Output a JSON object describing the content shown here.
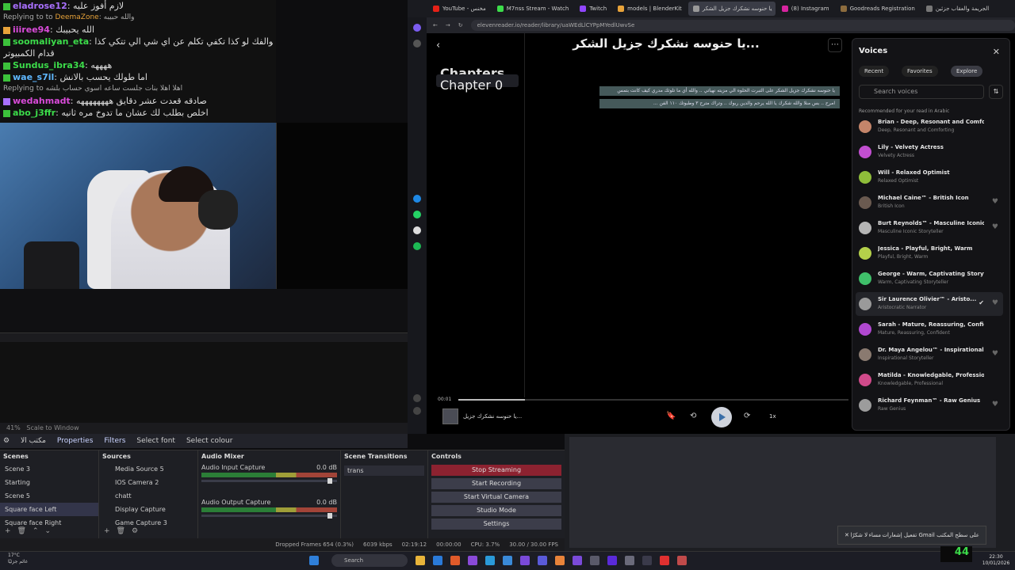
{
  "chat": {
    "lines": [
      {
        "user": "eladrose12",
        "user_color": "#a970ff",
        "text": "لازم أفوز عليه"
      },
      {
        "reply_to": "Replying to",
        "reply_user": "DeemaZone",
        "reply_text": "والله حبيبه"
      },
      {
        "user": "iiiree94",
        "user_color": "#d94bd9",
        "text": "الله يحبيبك"
      },
      {
        "user": "soomaliyan_eta",
        "user_color": "#3cdc4a",
        "text": "يخي سوالفك لو كذا تكفي تكلم عن اي شي الي تتكي كذا"
      },
      {
        "user": "",
        "user_color": "#ffffff",
        "text": "قدام الكمبيوتر"
      },
      {
        "user": "Sundus_ibra34",
        "user_color": "#3cdc4a",
        "text": "ههههه"
      },
      {
        "user": "wae_s7il",
        "user_color": "#5fb8ff",
        "text": "اما طولك يحسب بالانش"
      },
      {
        "reply_to": "Replying to",
        "reply_user": "",
        "reply_text": "اهلا اهلا بنات جلست ساعه اسوي حساب بلشه"
      },
      {
        "user": "wedahmadt",
        "user_color": "#d94bd9",
        "text": "صادقه قعدت عشر دقايق ههههههههه"
      },
      {
        "user": "abo_j3ffr",
        "user_color": "#3cdc4a",
        "text": "اخلص بطلب لك عشان ما تدوخ مره ثانيه"
      }
    ]
  },
  "obs": {
    "zoom": "41%",
    "scale_label": "Scale to Window",
    "toolbar": {
      "source_name": "مكتب الا",
      "properties": "Properties",
      "filters": "Filters",
      "select_font": "Select font",
      "select_colour": "Select colour"
    },
    "scenes": {
      "title": "Scenes",
      "items": [
        "Scene 3",
        "Starting",
        "Scene 5",
        "Square face Left",
        "Square face Right"
      ],
      "selected_index": 3
    },
    "sources": {
      "title": "Sources",
      "items": [
        "Media Source 5",
        "IOS Camera 2",
        "chatt",
        "Display Capture",
        "Game Capture 3"
      ]
    },
    "mixer": {
      "title": "Audio Mixer",
      "channels": [
        {
          "name": "Audio Input Capture",
          "db": "0.0 dB",
          "level": 0.62
        },
        {
          "name": "Audio Output Capture",
          "db": "0.0 dB",
          "level": 0.72
        }
      ]
    },
    "transitions": {
      "title": "Scene Transitions",
      "current": "trans"
    },
    "controls": {
      "title": "Controls",
      "buttons": [
        "Stop Streaming",
        "Start Recording",
        "Start Virtual Camera",
        "Studio Mode",
        "Settings"
      ]
    },
    "status": {
      "dropped": "Dropped Frames 654 (0.3%)",
      "bitrate": "6039 kbps",
      "live_time": "02:19:12",
      "rec_time": "00:00:00",
      "cpu": "CPU: 3.7%",
      "fps": "30.00 / 30.00 FPS"
    }
  },
  "browser": {
    "tabs": [
      {
        "label": "YouTube - مخنس",
        "color": "#e62117",
        "active": false
      },
      {
        "label": "M7nss Stream - Watch",
        "color": "#3cdc4a",
        "active": false
      },
      {
        "label": "Twitch",
        "color": "#9146ff",
        "active": false
      },
      {
        "label": "models | BlenderKit",
        "color": "#e8a33a",
        "active": false
      },
      {
        "label": "يا حنوسه نشكرك جزيل الشكر",
        "color": "#999999",
        "active": true
      },
      {
        "label": "(8) Instagram",
        "color": "#d6249f",
        "active": false
      },
      {
        "label": "Goodreads Registration",
        "color": "#8c6c3e",
        "active": false
      },
      {
        "label": "الجريمة والعقاب جزئين",
        "color": "#777777",
        "active": false
      }
    ],
    "url": "elevenreader.io/reader/library/uaWEdLlCYPpMYedlUwvSe"
  },
  "reader": {
    "title": "يا حنوسه نشكرك جزيل الشكر...",
    "chapters_label": "Chapters",
    "chapter_item": "Chapter 0",
    "highlight_lines": [
      "يا حنوسه نشكرك جزيل الشكر على التبرت الحلوه الي مزيته نهياتي .. والله أي ما تلوثك مدري كيف كانت بتمس",
      "... امرح .. بس منلا والله شكرك يا الله يرحم والدين ربوك .. وتراك مترح ٣ وطبوتك ١١٠ الفن"
    ],
    "player": {
      "time": "00:01",
      "progress": 0.17,
      "now_playing": "يا حنوسه نشكرك جزيل...",
      "speed": "1x"
    }
  },
  "voices": {
    "title": "Voices",
    "tabs": [
      "Recent",
      "Favorites",
      "Explore"
    ],
    "selected_tab": 2,
    "search_placeholder": "Search voices",
    "recommended_label": "Recommended for your read in Arabic",
    "items": [
      {
        "name": "Brian - Deep, Resonant and Comforting",
        "desc": "Deep, Resonant and Comforting",
        "color": "#c4856a",
        "heart": false,
        "selected": false
      },
      {
        "name": "Lily - Velvety Actress",
        "desc": "Velvety Actress",
        "color": "#c24fd0",
        "heart": false,
        "selected": false
      },
      {
        "name": "Will - Relaxed Optimist",
        "desc": "Relaxed Optimist",
        "color": "#8fbd3a",
        "heart": false,
        "selected": false
      },
      {
        "name": "Michael Caine™ - British Icon",
        "desc": "British Icon",
        "color": "#6a5a50",
        "heart": true,
        "selected": false
      },
      {
        "name": "Burt Reynolds™ - Masculine Iconic ...",
        "desc": "Masculine Iconic Storyteller",
        "color": "#b5b5b5",
        "heart": true,
        "selected": false
      },
      {
        "name": "Jessica - Playful, Bright, Warm",
        "desc": "Playful, Bright, Warm",
        "color": "#b4d04a",
        "heart": false,
        "selected": false
      },
      {
        "name": "George - Warm, Captivating Storyteller",
        "desc": "Warm, Captivating Storyteller",
        "color": "#3fbf6a",
        "heart": false,
        "selected": false
      },
      {
        "name": "Sir Laurence Olivier™ - Aristo...",
        "desc": "Aristocratic Narrator",
        "color": "#9a9a9a",
        "heart": true,
        "selected": true
      },
      {
        "name": "Sarah - Mature, Reassuring, Confident",
        "desc": "Mature, Reassuring, Confident",
        "color": "#b048d0",
        "heart": false,
        "selected": false
      },
      {
        "name": "Dr. Maya Angelou™ - Inspirational S...",
        "desc": "Inspirational Storyteller",
        "color": "#8a7a70",
        "heart": true,
        "selected": false
      },
      {
        "name": "Matilda - Knowledgable, Professional",
        "desc": "Knowledgable, Professional",
        "color": "#d04a8a",
        "heart": false,
        "selected": false
      },
      {
        "name": "Richard Feynman™ - Raw Genius",
        "desc": "Raw Genius",
        "color": "#9c9c9c",
        "heart": true,
        "selected": false
      }
    ]
  },
  "toast": {
    "text": "تفعيل إشعارات Gmail على سطح المكتب",
    "action1": "مساء",
    "action2": "لا شكرًا"
  },
  "taskbar": {
    "weather_temp": "17°C",
    "weather_desc": "غائم جزئيًا",
    "search": "Search",
    "time": "22:30",
    "date": "10/01/2026",
    "badge": "44"
  }
}
